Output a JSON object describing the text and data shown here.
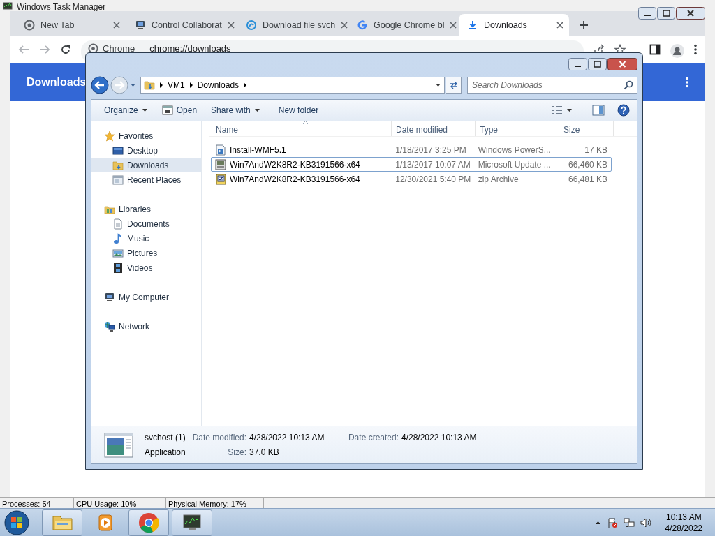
{
  "task_manager": {
    "title": "Windows Task Manager",
    "status": [
      "Processes: 54",
      "CPU Usage: 10%",
      "Physical Memory: 17%"
    ]
  },
  "chrome": {
    "tabs": [
      {
        "label": "New Tab",
        "kind": "chrome",
        "selected": false
      },
      {
        "label": "Control Collaborat",
        "kind": "computer",
        "selected": false
      },
      {
        "label": "Download file svch",
        "kind": "swirl",
        "selected": false
      },
      {
        "label": "Google Chrome bl",
        "kind": "google",
        "selected": false
      },
      {
        "label": "Downloads",
        "kind": "download",
        "selected": true
      }
    ],
    "address": {
      "site_label": "Chrome",
      "url": "chrome://downloads"
    },
    "page_title": "Downloads"
  },
  "explorer": {
    "breadcrumb": [
      "VM1",
      "Downloads"
    ],
    "search": {
      "placeholder": "Search Downloads"
    },
    "commands": [
      {
        "label": "Organize",
        "kind": "text",
        "dropdown": true
      },
      {
        "label": "Open",
        "kind": "open",
        "dropdown": false
      },
      {
        "label": "Share with",
        "kind": "text",
        "dropdown": true
      },
      {
        "label": "New folder",
        "kind": "text",
        "dropdown": false
      }
    ],
    "navigation": [
      {
        "label": "Favorites",
        "kind": "star",
        "selected": false,
        "children": [
          {
            "label": "Desktop",
            "kind": "desktop",
            "selected": false
          },
          {
            "label": "Downloads",
            "kind": "folder",
            "selected": true
          },
          {
            "label": "Recent Places",
            "kind": "recent",
            "selected": false
          }
        ]
      },
      {
        "label": "Libraries",
        "kind": "library",
        "selected": false,
        "children": [
          {
            "label": "Documents",
            "kind": "document",
            "selected": false
          },
          {
            "label": "Music",
            "kind": "music",
            "selected": false
          },
          {
            "label": "Pictures",
            "kind": "pictures",
            "selected": false
          },
          {
            "label": "Videos",
            "kind": "videos",
            "selected": false
          }
        ]
      },
      {
        "label": "My Computer",
        "kind": "computer",
        "selected": false
      },
      {
        "label": "Network",
        "kind": "network",
        "selected": false
      }
    ],
    "columns": [
      "Name",
      "Date modified",
      "Type",
      "Size"
    ],
    "files": [
      {
        "name": "Install-WMF5.1",
        "date": "1/18/2017 3:25 PM",
        "type": "Windows PowerS...",
        "size": "17 KB",
        "kind": "script",
        "selected": false
      },
      {
        "name": "Win7AndW2K8R2-KB3191566-x64",
        "date": "1/13/2017 10:07 AM",
        "type": "Microsoft Update ...",
        "size": "66,460 KB",
        "kind": "update",
        "selected": true
      },
      {
        "name": "Win7AndW2K8R2-KB3191566-x64",
        "date": "12/30/2021 5:40 PM",
        "type": "zip Archive",
        "size": "66,481 KB",
        "kind": "zip",
        "selected": false
      }
    ],
    "details": {
      "name": "svchost (1)",
      "type": "Application",
      "fields": [
        {
          "label": "Date modified:",
          "value": "4/28/2022 10:13 AM"
        },
        {
          "label": "Date created:",
          "value": "4/28/2022 10:13 AM"
        },
        {
          "label": "Size:",
          "value": "37.0 KB"
        }
      ]
    }
  },
  "taskbar": {
    "apps": [
      {
        "kind": "folder",
        "running": true
      },
      {
        "kind": "media",
        "running": false
      },
      {
        "kind": "chrome",
        "running": true
      },
      {
        "kind": "monitor",
        "running": true
      }
    ],
    "time": "10:13 AM",
    "date": "4/28/2022"
  }
}
